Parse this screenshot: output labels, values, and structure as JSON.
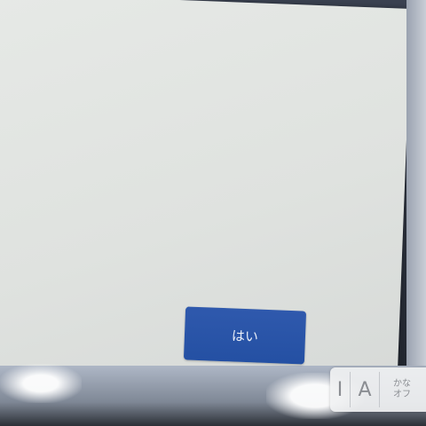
{
  "dialog": {
    "confirm_label": "はい"
  },
  "ime_toolbar": {
    "cursor_glyph": "I",
    "alpha_label": "A",
    "kana_line1": "かな",
    "kana_line2": "オフ"
  },
  "colors": {
    "screen_bg": "#e2e5e2",
    "button_bg": "#2a55a8",
    "button_text": "#e9eef8"
  }
}
